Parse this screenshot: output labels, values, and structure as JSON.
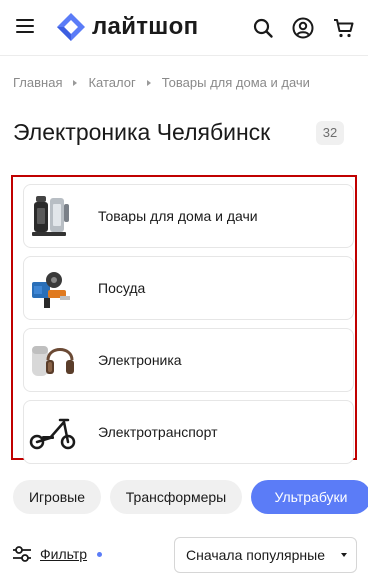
{
  "header": {
    "logo_text": "лайтшоп",
    "brand_color": "#5b7cf7",
    "icons": [
      "menu-icon",
      "search-icon",
      "user-icon",
      "cart-icon"
    ]
  },
  "breadcrumb": {
    "items": [
      "Главная",
      "Каталог",
      "Товары для дома и дачи"
    ]
  },
  "page": {
    "title": "Электроника Челябинск",
    "count": "32"
  },
  "categories": [
    {
      "label": "Товары для дома и дачи",
      "icon": "kettle-icon"
    },
    {
      "label": "Посуда",
      "icon": "grinder-icon"
    },
    {
      "label": "Электроника",
      "icon": "headphones-speaker-icon"
    },
    {
      "label": "Электротранспорт",
      "icon": "scooter-icon"
    }
  ],
  "chips": [
    {
      "label": "Игровые",
      "active": false
    },
    {
      "label": "Трансформеры",
      "active": false
    },
    {
      "label": "Ультрабуки",
      "active": true
    }
  ],
  "filter": {
    "label": "Фильтр"
  },
  "sort": {
    "selected": "Сначала популярные"
  },
  "colors": {
    "accent": "#5b7cf7",
    "highlight_border": "#c00000"
  }
}
